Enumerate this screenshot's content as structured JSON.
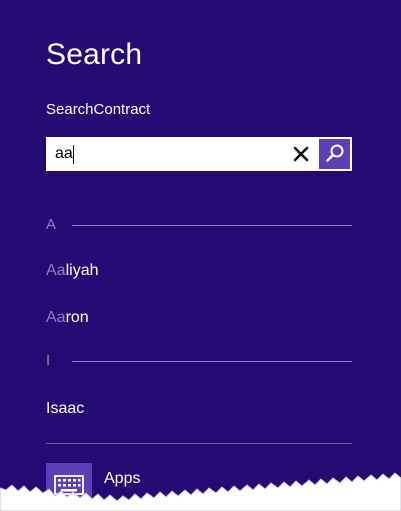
{
  "pane": {
    "title": "Search",
    "app_name": "SearchContract"
  },
  "search": {
    "value": "aa",
    "clear_icon": "close-icon",
    "submit_icon": "magnifier-icon"
  },
  "results": {
    "groups": [
      {
        "letter": "A",
        "items": [
          {
            "match": "Aa",
            "rest": "liyah"
          },
          {
            "match": "Aa",
            "rest": "ron"
          }
        ]
      },
      {
        "letter": "I",
        "items": [
          {
            "match": "",
            "rest": "Isaac"
          }
        ]
      }
    ]
  },
  "apps": {
    "label": "Apps",
    "icon": "keyboard-icon"
  },
  "colors": {
    "background": "#250a72",
    "accent": "#5b3fb5",
    "muted": "#8d80bf",
    "text": "#ffffff"
  }
}
